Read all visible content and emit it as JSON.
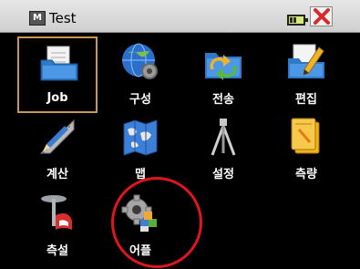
{
  "window": {
    "title": "Test"
  },
  "apps": [
    {
      "label": "Job",
      "icon": "folder-document-icon",
      "selected": true
    },
    {
      "label": "구성",
      "icon": "globe-gear-icon"
    },
    {
      "label": "전송",
      "icon": "folder-transfer-icon"
    },
    {
      "label": "편집",
      "icon": "folder-edit-icon"
    },
    {
      "label": "계산",
      "icon": "ruler-pencil-icon"
    },
    {
      "label": "맵",
      "icon": "world-map-icon"
    },
    {
      "label": "설정",
      "icon": "tripod-icon"
    },
    {
      "label": "측량",
      "icon": "notebook-icon"
    },
    {
      "label": "측설",
      "icon": "stakeout-pin-icon"
    },
    {
      "label": "어플",
      "icon": "gear-blocks-icon"
    }
  ],
  "highlight": {
    "target": "어플",
    "color": "#e0151f"
  }
}
